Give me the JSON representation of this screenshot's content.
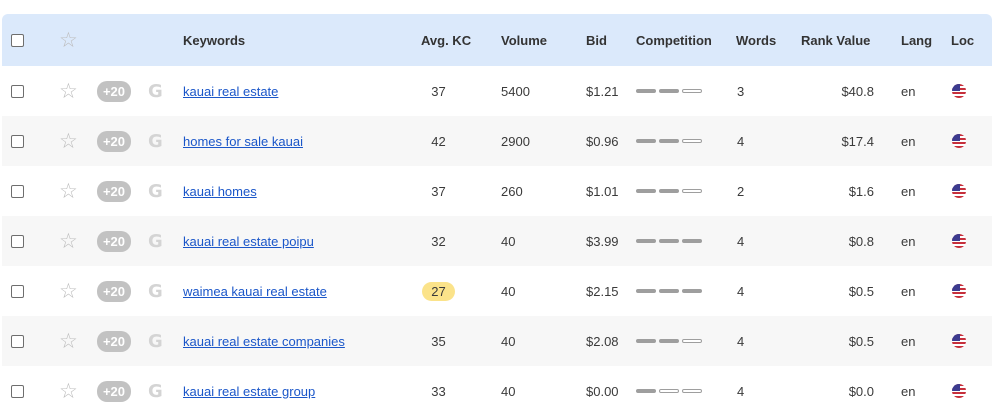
{
  "header": {
    "keywords": "Keywords",
    "avg_kc": "Avg. KC",
    "volume": "Volume",
    "bid": "Bid",
    "competition": "Competition",
    "words": "Words",
    "rank_value": "Rank Value",
    "lang": "Lang",
    "loc": "Loc"
  },
  "rows": [
    {
      "plus": "+20",
      "keyword": "kauai real estate",
      "kc": "37",
      "kc_highlight": false,
      "volume": "5400",
      "bid": "$1.21",
      "competition_level": 2,
      "words": "3",
      "rank_value": "$40.8",
      "lang": "en",
      "loc_icon": "us-flag-icon"
    },
    {
      "plus": "+20",
      "keyword": "homes for sale kauai",
      "kc": "42",
      "kc_highlight": false,
      "volume": "2900",
      "bid": "$0.96",
      "competition_level": 2,
      "words": "4",
      "rank_value": "$17.4",
      "lang": "en",
      "loc_icon": "us-flag-icon"
    },
    {
      "plus": "+20",
      "keyword": "kauai homes",
      "kc": "37",
      "kc_highlight": false,
      "volume": "260",
      "bid": "$1.01",
      "competition_level": 2,
      "words": "2",
      "rank_value": "$1.6",
      "lang": "en",
      "loc_icon": "us-flag-icon"
    },
    {
      "plus": "+20",
      "keyword": "kauai real estate poipu",
      "kc": "32",
      "kc_highlight": false,
      "volume": "40",
      "bid": "$3.99",
      "competition_level": 3,
      "words": "4",
      "rank_value": "$0.8",
      "lang": "en",
      "loc_icon": "us-flag-icon"
    },
    {
      "plus": "+20",
      "keyword": "waimea kauai real estate",
      "kc": "27",
      "kc_highlight": true,
      "volume": "40",
      "bid": "$2.15",
      "competition_level": 3,
      "words": "4",
      "rank_value": "$0.5",
      "lang": "en",
      "loc_icon": "us-flag-icon"
    },
    {
      "plus": "+20",
      "keyword": "kauai real estate companies",
      "kc": "35",
      "kc_highlight": false,
      "volume": "40",
      "bid": "$2.08",
      "competition_level": 2,
      "words": "4",
      "rank_value": "$0.5",
      "lang": "en",
      "loc_icon": "us-flag-icon"
    },
    {
      "plus": "+20",
      "keyword": "kauai real estate group",
      "kc": "33",
      "kc_highlight": false,
      "volume": "40",
      "bid": "$0.00",
      "competition_level": 1,
      "words": "4",
      "rank_value": "$0.0",
      "lang": "en",
      "loc_icon": "us-flag-icon"
    }
  ]
}
